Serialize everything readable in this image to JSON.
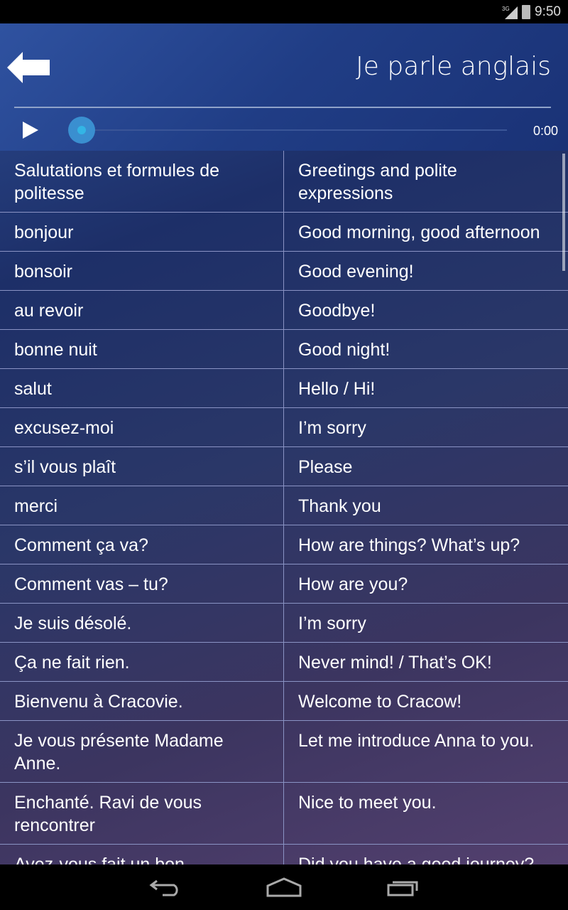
{
  "status_bar": {
    "network": "3G",
    "time": "9:50",
    "icons": [
      "signal-icon",
      "battery-icon"
    ]
  },
  "header": {
    "title": "Je parle anglais",
    "back_icon": "arrow-left-icon"
  },
  "player": {
    "time": "0:00",
    "progress": 0,
    "play_icon": "play-icon"
  },
  "rows": [
    {
      "fr": "Salutations et formules de politesse",
      "en": "Greetings and polite expressions"
    },
    {
      "fr": "bonjour",
      "en": "Good morning, good afternoon"
    },
    {
      "fr": "bonsoir",
      "en": "Good evening!"
    },
    {
      "fr": "au revoir",
      "en": "Goodbye!"
    },
    {
      "fr": "bonne nuit",
      "en": "Good night!"
    },
    {
      "fr": "salut",
      "en": "Hello / Hi!"
    },
    {
      "fr": "excusez-moi",
      "en": "I’m sorry"
    },
    {
      "fr": "s’il vous plaît",
      "en": "Please"
    },
    {
      "fr": "merci",
      "en": "Thank you"
    },
    {
      "fr": "Comment ça va?",
      "en": "How are things? What’s up?"
    },
    {
      "fr": "Comment vas – tu?",
      "en": "How are you?"
    },
    {
      "fr": "Je suis désolé.",
      "en": "I’m sorry"
    },
    {
      "fr": "Ça ne fait rien.",
      "en": "Never mind! / That’s OK!"
    },
    {
      "fr": "Bienvenu à Cracovie.",
      "en": "Welcome to Cracow!"
    },
    {
      "fr": "Je vous présente Madame Anne.",
      "en": "Let me introduce Anna to you."
    },
    {
      "fr": "Enchanté. Ravi de vous rencontrer",
      "en": "Nice to meet you."
    },
    {
      "fr": "Avez-vous fait un bon",
      "en": "Did you have a good journey?"
    }
  ],
  "nav": {
    "icons": [
      "back-icon",
      "home-icon",
      "recents-icon"
    ]
  }
}
